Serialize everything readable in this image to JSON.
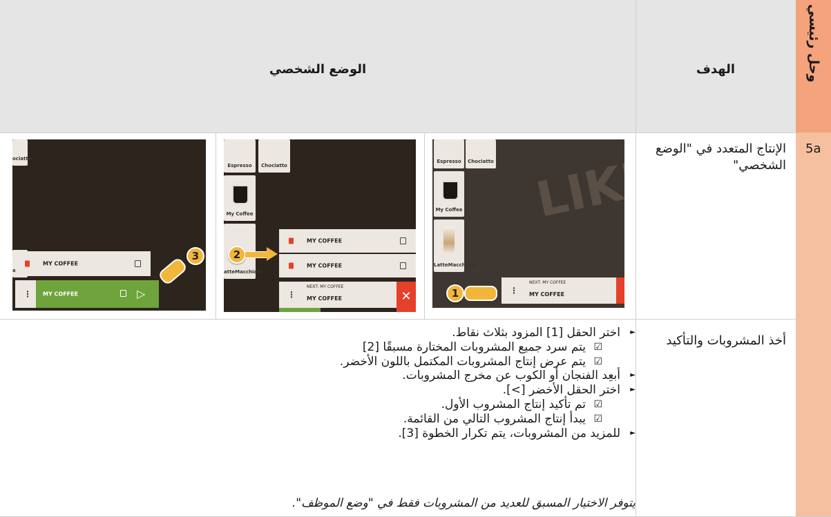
{
  "side_label": "وحل رئيسي",
  "header": {
    "mode": "الوضع الشخصي",
    "goal": "الهدف"
  },
  "row1": {
    "id": "5a",
    "goal_text": "الإنتاج المتعدد في \"الوضع الشخصي\""
  },
  "photo1": {
    "tiles": [
      "Espresso",
      "Chociatto",
      "My Coffee",
      "LatteMacchiato"
    ],
    "watermark": "LIKE",
    "bar_next": "NEXT: MY COFFEE",
    "bar_name": "MY COFFEE",
    "badge": "1"
  },
  "photo2": {
    "tiles": [
      "Espresso",
      "Chociatto",
      "My Coffee",
      "atteMacchiato"
    ],
    "list_item_1": "MY COFFEE",
    "list_item_2": "MY COFFEE",
    "bar_next": "NEXT: MY COFFEE",
    "bar_name": "MY COFFEE",
    "badge": "2"
  },
  "photo3": {
    "tiles": [
      "ociatto",
      "atteMacchiato"
    ],
    "list_item": "MY COFFEE",
    "bar_name": "MY COFFEE",
    "badge": "3"
  },
  "row2": {
    "goal_text": "أخذ المشروبات والتأكيد",
    "steps": [
      {
        "type": "step",
        "text": "اختر الحقل [1] المزود بثلاث نقاط."
      },
      {
        "type": "sub",
        "text": "يتم سرد جميع المشروبات المختارة مسبقًا [2]"
      },
      {
        "type": "sub",
        "text": "يتم عرض إنتاج المشروبات المكتمل باللون الأخضر."
      },
      {
        "type": "step",
        "text": "أبعِد الفنجان أو الكوب عن مخرج المشروبات."
      },
      {
        "type": "step",
        "text": "اختر الحقل الأخضر [>]."
      },
      {
        "type": "sub",
        "text": "تم تأكيد إنتاج المشروب الأول."
      },
      {
        "type": "sub",
        "text": "يبدأ إنتاج المشروب التالي من القائمة."
      },
      {
        "type": "step",
        "text": "للمزيد من المشروبات، يتم تكرار الخطوة [3]."
      }
    ],
    "note": "يتوفر الاختيار المسبق للعديد من المشروبات فقط في \"وضع الموظف\"."
  },
  "icons": {
    "step_arrow": "triangle-right-icon",
    "check": "checkbox-checked-icon"
  },
  "colors": {
    "side_bar": "#f4a37c",
    "header_bg": "#e5e5e5",
    "green": "#6fa33c",
    "badge": "#f2b63a",
    "delete_red": "#e5402a"
  }
}
